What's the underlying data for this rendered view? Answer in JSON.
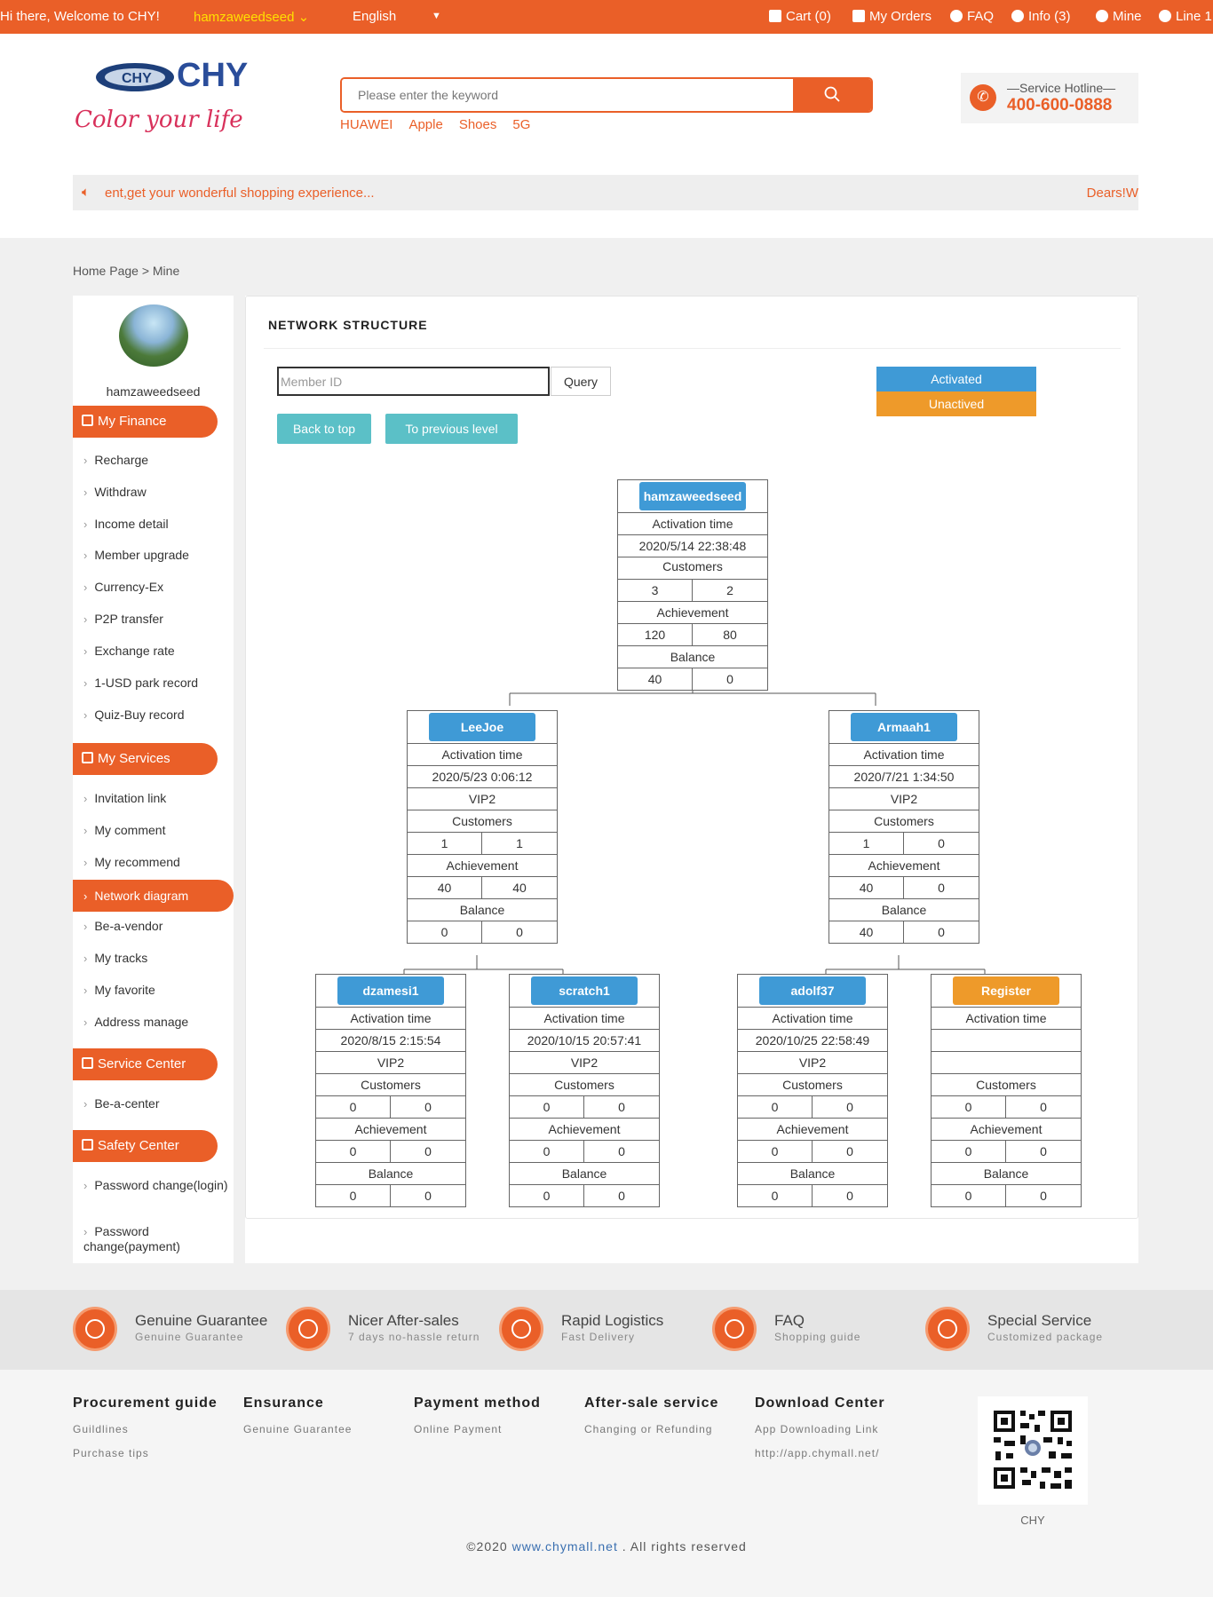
{
  "topbar": {
    "greeting": "Hi there,  Welcome to CHY!",
    "username": "hamzaweedseed",
    "language": "English",
    "cart": "Cart (0)",
    "orders": "My Orders",
    "faq": "FAQ",
    "info": "Info (3)",
    "mine": "Mine",
    "line": "Line 1"
  },
  "header": {
    "logo_text": "CHY",
    "logo_slogan": "Color your life",
    "search_placeholder": "Please enter the keyword",
    "hot_words": [
      "HUAWEI",
      "Apple",
      "Shoes",
      "5G"
    ],
    "hotline_label": "—Service Hotline—",
    "hotline_number": "400-600-0888",
    "notice_text": "ent,get your wonderful shopping experience...",
    "notice_text_2": "Dears!W"
  },
  "breadcrumb": "Home Page > Mine",
  "sidebar": {
    "username": "hamzaweedseed",
    "sections": [
      {
        "title": "My Finance",
        "items": [
          "Recharge",
          "Withdraw",
          "Income detail",
          "Member upgrade",
          "Currency-Ex",
          "P2P transfer",
          "Exchange rate",
          "1-USD park record",
          "Quiz-Buy record"
        ]
      },
      {
        "title": "My Services",
        "items": [
          "Invitation link",
          "My comment",
          "My recommend",
          "Network diagram",
          "Be-a-vendor",
          "My tracks",
          "My favorite",
          "Address manage"
        ]
      },
      {
        "title": "Service Center",
        "items": [
          "Be-a-center"
        ]
      },
      {
        "title": "Safety Center",
        "items": [
          "Password change(login)",
          "Password change(payment)"
        ]
      }
    ],
    "active_item": "Network diagram"
  },
  "network": {
    "title": "NETWORK STRUCTURE",
    "member_placeholder": "Member ID",
    "query_label": "Query",
    "back_top_label": "Back to top",
    "prev_level_label": "To previous level",
    "legend_activated": "Activated",
    "legend_unactived": "Unactived",
    "labels": {
      "activation_time": "Activation time",
      "customers": "Customers",
      "achievement": "Achievement",
      "balance": "Balance"
    },
    "nodes": [
      {
        "id": "hamzaweedseed",
        "status": "activated",
        "activation_time": "2020/5/14 22:38:48",
        "level": "",
        "customers": [
          "3",
          "2"
        ],
        "achievement": [
          "120",
          "80"
        ],
        "balance": [
          "40",
          "0"
        ]
      },
      {
        "id": "LeeJoe",
        "status": "activated",
        "activation_time": "2020/5/23 0:06:12",
        "level": "VIP2",
        "customers": [
          "1",
          "1"
        ],
        "achievement": [
          "40",
          "40"
        ],
        "balance": [
          "0",
          "0"
        ]
      },
      {
        "id": "Armaah1",
        "status": "activated",
        "activation_time": "2020/7/21 1:34:50",
        "level": "VIP2",
        "customers": [
          "1",
          "0"
        ],
        "achievement": [
          "40",
          "0"
        ],
        "balance": [
          "40",
          "0"
        ]
      },
      {
        "id": "dzamesi1",
        "status": "activated",
        "activation_time": "2020/8/15 2:15:54",
        "level": "VIP2",
        "customers": [
          "0",
          "0"
        ],
        "achievement": [
          "0",
          "0"
        ],
        "balance": [
          "0",
          "0"
        ]
      },
      {
        "id": "scratch1",
        "status": "activated",
        "activation_time": "2020/10/15 20:57:41",
        "level": "VIP2",
        "customers": [
          "0",
          "0"
        ],
        "achievement": [
          "0",
          "0"
        ],
        "balance": [
          "0",
          "0"
        ]
      },
      {
        "id": "adolf37",
        "status": "activated",
        "activation_time": "2020/10/25 22:58:49",
        "level": "VIP2",
        "customers": [
          "0",
          "0"
        ],
        "achievement": [
          "0",
          "0"
        ],
        "balance": [
          "0",
          "0"
        ]
      },
      {
        "id": "Register",
        "status": "unactived",
        "activation_time": "",
        "level": "",
        "customers": [
          "0",
          "0"
        ],
        "achievement": [
          "0",
          "0"
        ],
        "balance": [
          "0",
          "0"
        ]
      }
    ]
  },
  "features": [
    {
      "title": "Genuine Guarantee",
      "sub": "Genuine Guarantee",
      "icon": "shield-icon"
    },
    {
      "title": "Nicer After-sales",
      "sub": "7 days no-hassle return",
      "icon": "yen-icon"
    },
    {
      "title": "Rapid Logistics",
      "sub": "Fast Delivery",
      "icon": "truck-icon"
    },
    {
      "title": "FAQ",
      "sub": "Shopping guide",
      "icon": "question-icon"
    },
    {
      "title": "Special Service",
      "sub": "Customized package",
      "icon": "medal-icon"
    }
  ],
  "footer": {
    "columns": [
      {
        "title": "Procurement guide",
        "links": [
          "Guildlines",
          "Purchase tips"
        ]
      },
      {
        "title": "Ensurance",
        "links": [
          "Genuine Guarantee"
        ]
      },
      {
        "title": "Payment method",
        "links": [
          "Online Payment"
        ]
      },
      {
        "title": "After-sale service",
        "links": [
          "Changing or Refunding"
        ]
      },
      {
        "title": "Download Center",
        "links": [
          "App Downloading Link",
          "http://app.chymall.net/"
        ]
      }
    ],
    "qr_label": "CHY",
    "copyright_prefix": "©2020 ",
    "copyright_link": "www.chymall.net",
    "copyright_suffix": " . All rights reserved"
  },
  "colors": {
    "brand": "#ea5f28",
    "activated": "#3f9ad6",
    "unactived": "#ee9a2a",
    "teal_button": "#5bc0c7"
  }
}
